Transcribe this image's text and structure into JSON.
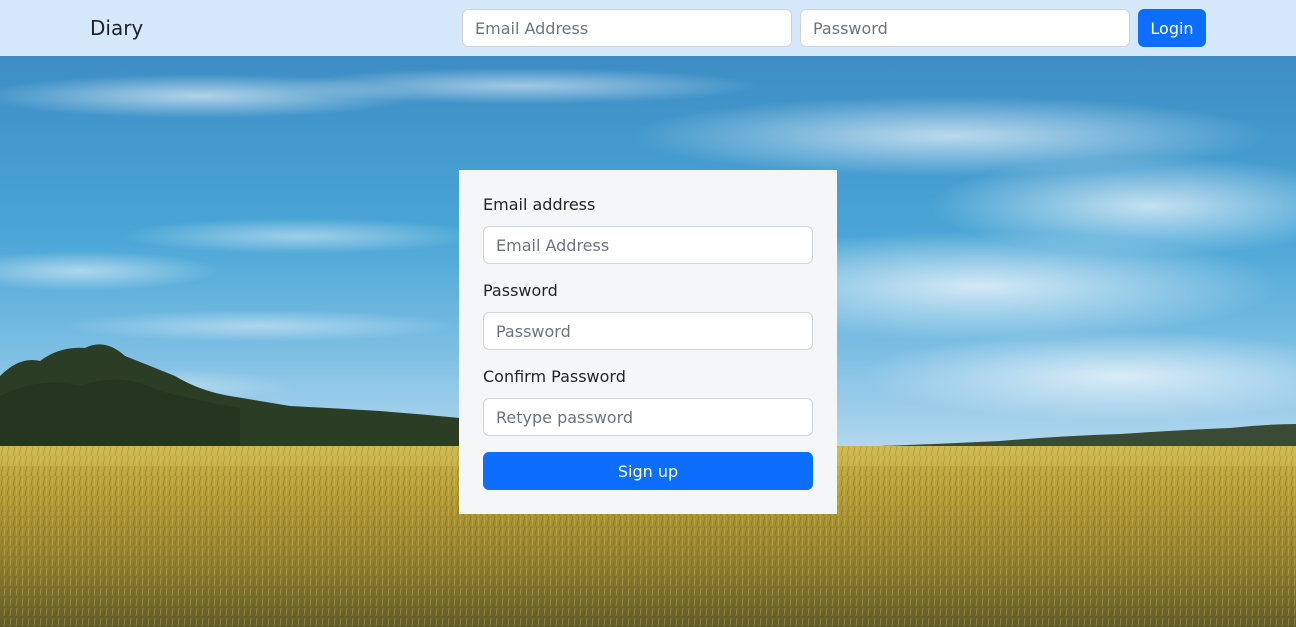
{
  "navbar": {
    "brand": "Diary",
    "email_placeholder": "Email Address",
    "password_placeholder": "Password",
    "login_label": "Login"
  },
  "signup_form": {
    "email_label": "Email address",
    "email_placeholder": "Email Address",
    "password_label": "Password",
    "password_placeholder": "Password",
    "confirm_label": "Confirm Password",
    "confirm_placeholder": "Retype password",
    "submit_label": "Sign up"
  },
  "colors": {
    "navbar_bg": "#d6e9fb",
    "primary": "#0d6efd",
    "card_bg": "#f5f6f8"
  }
}
